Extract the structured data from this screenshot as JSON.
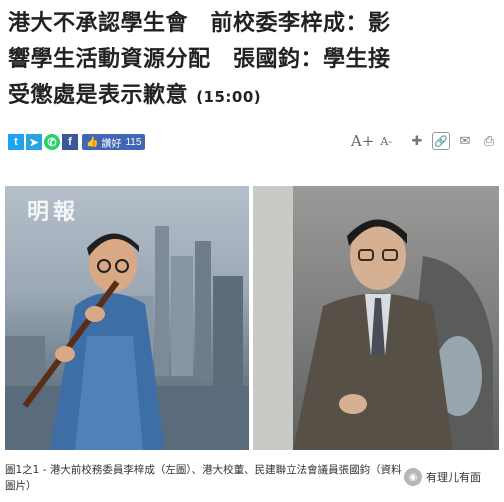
{
  "headline": {
    "line1": "港大不承認學生會　前校委李梓成：影",
    "line2": "響學生活動資源分配　張國鈞：學生接",
    "line3": "受懲處是表示歉意",
    "time": "(15:00)"
  },
  "share": {
    "twitter_glyph": "t",
    "telegram_glyph": "➤",
    "whatsapp_glyph": "✆",
    "facebook_glyph": "f",
    "like_label": "讚好",
    "like_count": "115"
  },
  "tools": {
    "font_up": "A+",
    "font_down": "A-",
    "bookmark_glyph": "✚",
    "link_glyph": "🔗",
    "mail_glyph": "✉",
    "print_glyph": "⎙"
  },
  "photo_left": {
    "watermark": "明報"
  },
  "caption": {
    "text": "圖1之1 - 港大前校務委員李梓成（左圖）、港大校董、民建聯立法會議員張國鈞（資料圖片）"
  },
  "brand": {
    "name": "有理儿有面",
    "logo_glyph": "◉"
  },
  "colors": {
    "twitter": "#1da1f2",
    "telegram": "#2aa3de",
    "whatsapp": "#25d366",
    "facebook": "#3b5998"
  }
}
